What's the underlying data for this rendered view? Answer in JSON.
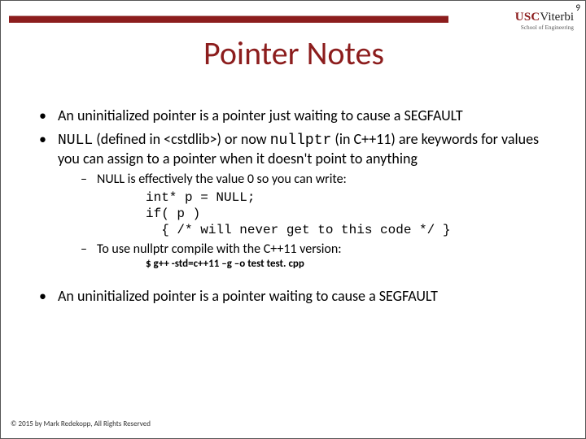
{
  "page_number": "9",
  "logo": {
    "usc": "USC",
    "viterbi": "Viterbi",
    "subline": "School of Engineering"
  },
  "title": "Pointer Notes",
  "bullets": {
    "b1": "An uninitialized pointer is a pointer just waiting to cause a SEGFAULT",
    "b2_pre": "NULL",
    "b2_mid1": " (defined in <cstdlib>) or now ",
    "b2_code": "nullptr",
    "b2_mid2": " (in C++11) are keywords for values you can assign to a pointer when it doesn't point to anything",
    "s1": "NULL is effectively the value 0 so you can write:",
    "code": "int* p = NULL;\nif( p )\n  { /* will never get to this code */ }",
    "s2": "To use nullptr compile with the C++11 version:",
    "cmd": "$ g++ -std=c++11 –g –o test test. cpp",
    "b3": "An uninitialized pointer is a pointer waiting to cause a SEGFAULT"
  },
  "footer": "© 2015 by Mark Redekopp, All Rights Reserved"
}
